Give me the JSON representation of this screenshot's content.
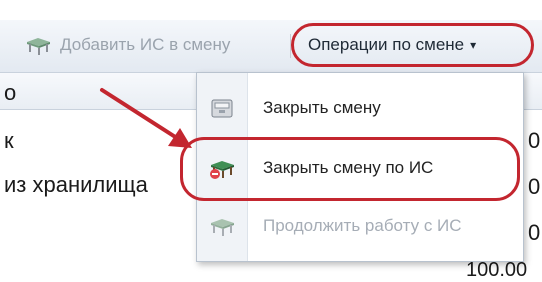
{
  "toolbar": {
    "add_label": "Добавить ИС в смену",
    "ops_label": "Операции по смене",
    "ops_caret": "▾"
  },
  "grid": {
    "header_fragment": "о",
    "row1_fragment": "к",
    "row2_fragment": "из хранилища",
    "col_tail_1": "0",
    "col_tail_2": "0",
    "col_tail_3": "0",
    "bottom_value": "100.00"
  },
  "menu": {
    "items": [
      {
        "label": "Закрыть смену",
        "icon": "register-icon",
        "enabled": true
      },
      {
        "label": "Закрыть смену по ИС",
        "icon": "table-close-icon",
        "enabled": true
      },
      {
        "label": "Продолжить работу с ИС",
        "icon": "table-icon",
        "enabled": false
      }
    ]
  },
  "annotations": {
    "highlight_color": "#c3262f"
  }
}
